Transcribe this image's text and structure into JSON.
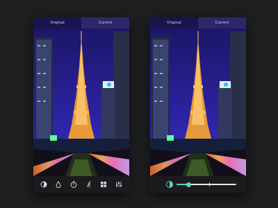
{
  "phones": [
    {
      "tabs": {
        "original_label": "Original",
        "current_label": "Current"
      },
      "toolbar": {
        "tools": [
          {
            "icon": "contrast-icon"
          },
          {
            "icon": "drop-icon"
          },
          {
            "icon": "timer-icon"
          },
          {
            "icon": "run-icon"
          },
          {
            "icon": "grid-icon"
          },
          {
            "icon": "sliders-icon"
          }
        ]
      }
    },
    {
      "tabs": {
        "original_label": "Original",
        "current_label": "Current"
      },
      "adjustment": {
        "icon": "contrast-icon",
        "value": 0.2,
        "mark": 0.55,
        "accent": "#5fd3b7"
      }
    }
  ]
}
